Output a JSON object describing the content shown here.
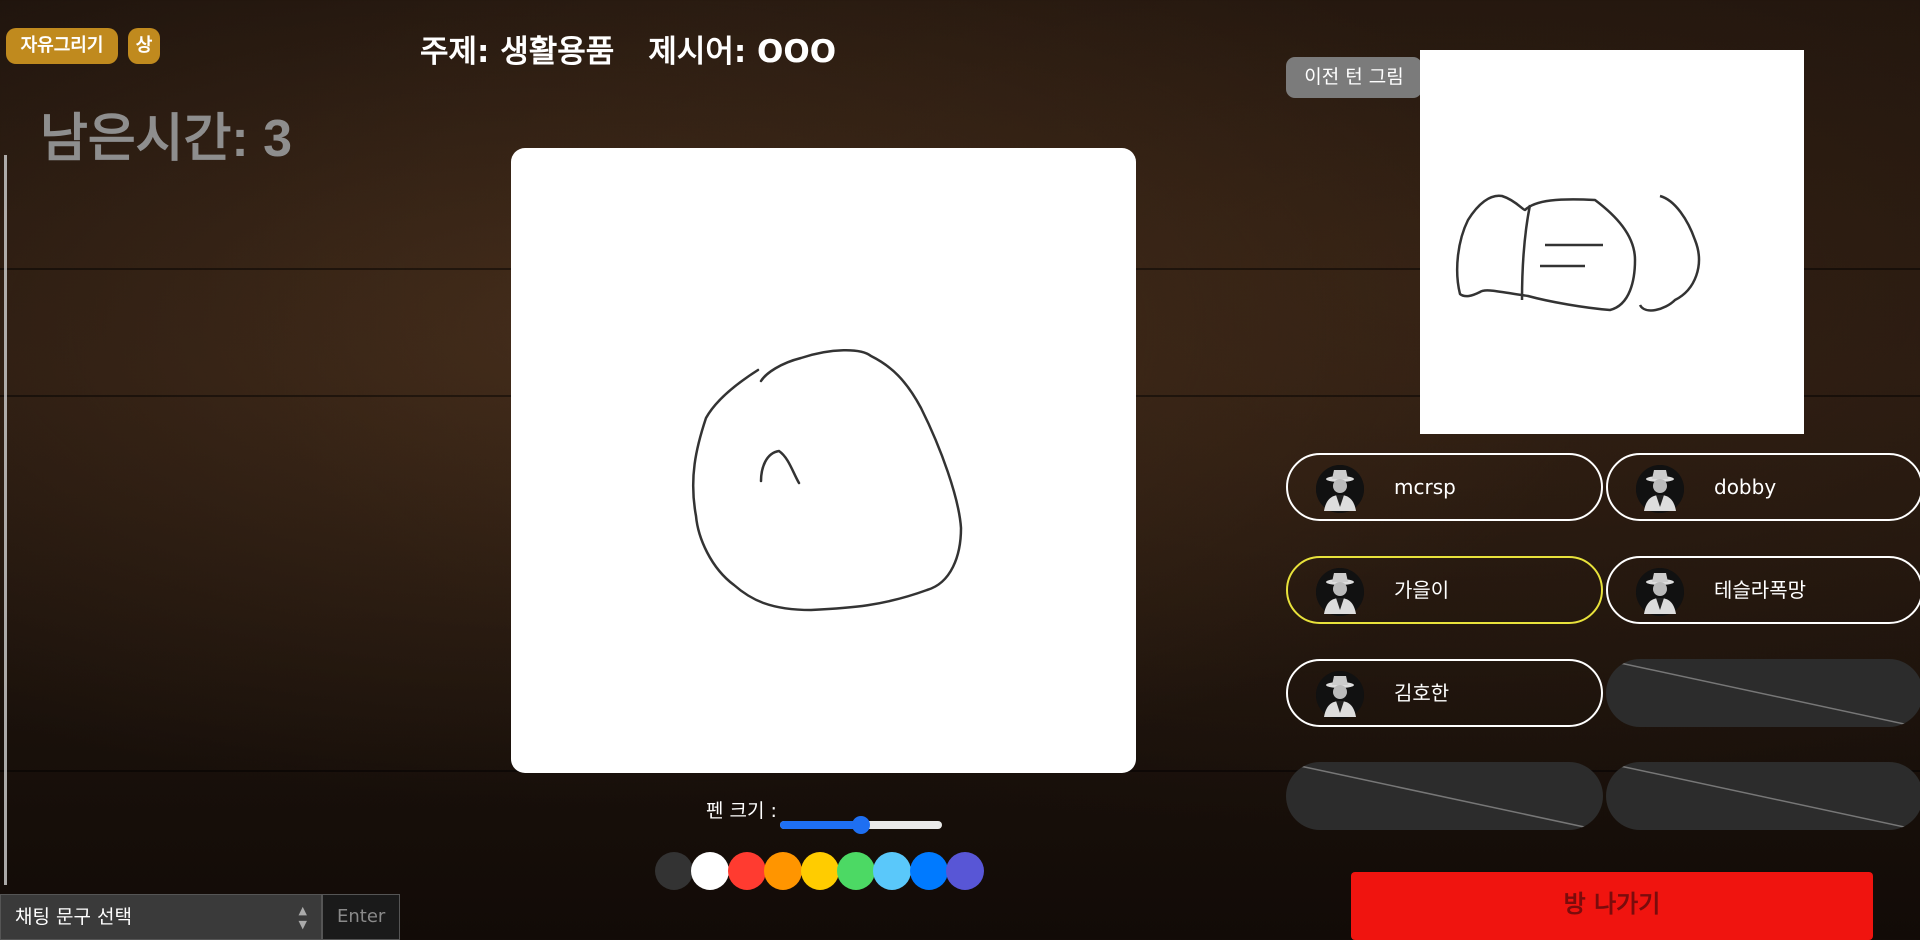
{
  "header": {
    "mode_badge": "자유그리기",
    "level_badge": "상",
    "timer": "남은시간: 3",
    "topic": "주제: 생활용품",
    "hint": "제시어: OOO"
  },
  "canvas": {
    "background": "#ffffff"
  },
  "pen": {
    "label": "펜 크기 :",
    "size_fraction": 0.5
  },
  "palette": {
    "colors": [
      "#333333",
      "#ffffff",
      "#ff3b30",
      "#ff9500",
      "#ffcc00",
      "#4cd964",
      "#5ac8fa",
      "#007aff",
      "#5856d6"
    ]
  },
  "previous_turn": {
    "button_label": "이전 턴 그림"
  },
  "players": [
    {
      "name": "mcrsp",
      "active": false
    },
    {
      "name": "dobby",
      "active": false
    },
    {
      "name": "가을이",
      "active": true
    },
    {
      "name": "테슬라폭망",
      "active": false
    },
    {
      "name": "김호한",
      "active": false
    }
  ],
  "empty_slots": 3,
  "exit_button": "방 나가기",
  "chat": {
    "select_label": "채팅 문구 선택",
    "input_placeholder": "Enter"
  },
  "colors": {
    "badge": "#c08a1e",
    "active_player": "#e8e23b",
    "exit": "#f0140f",
    "slider": "#1e6ff2"
  }
}
